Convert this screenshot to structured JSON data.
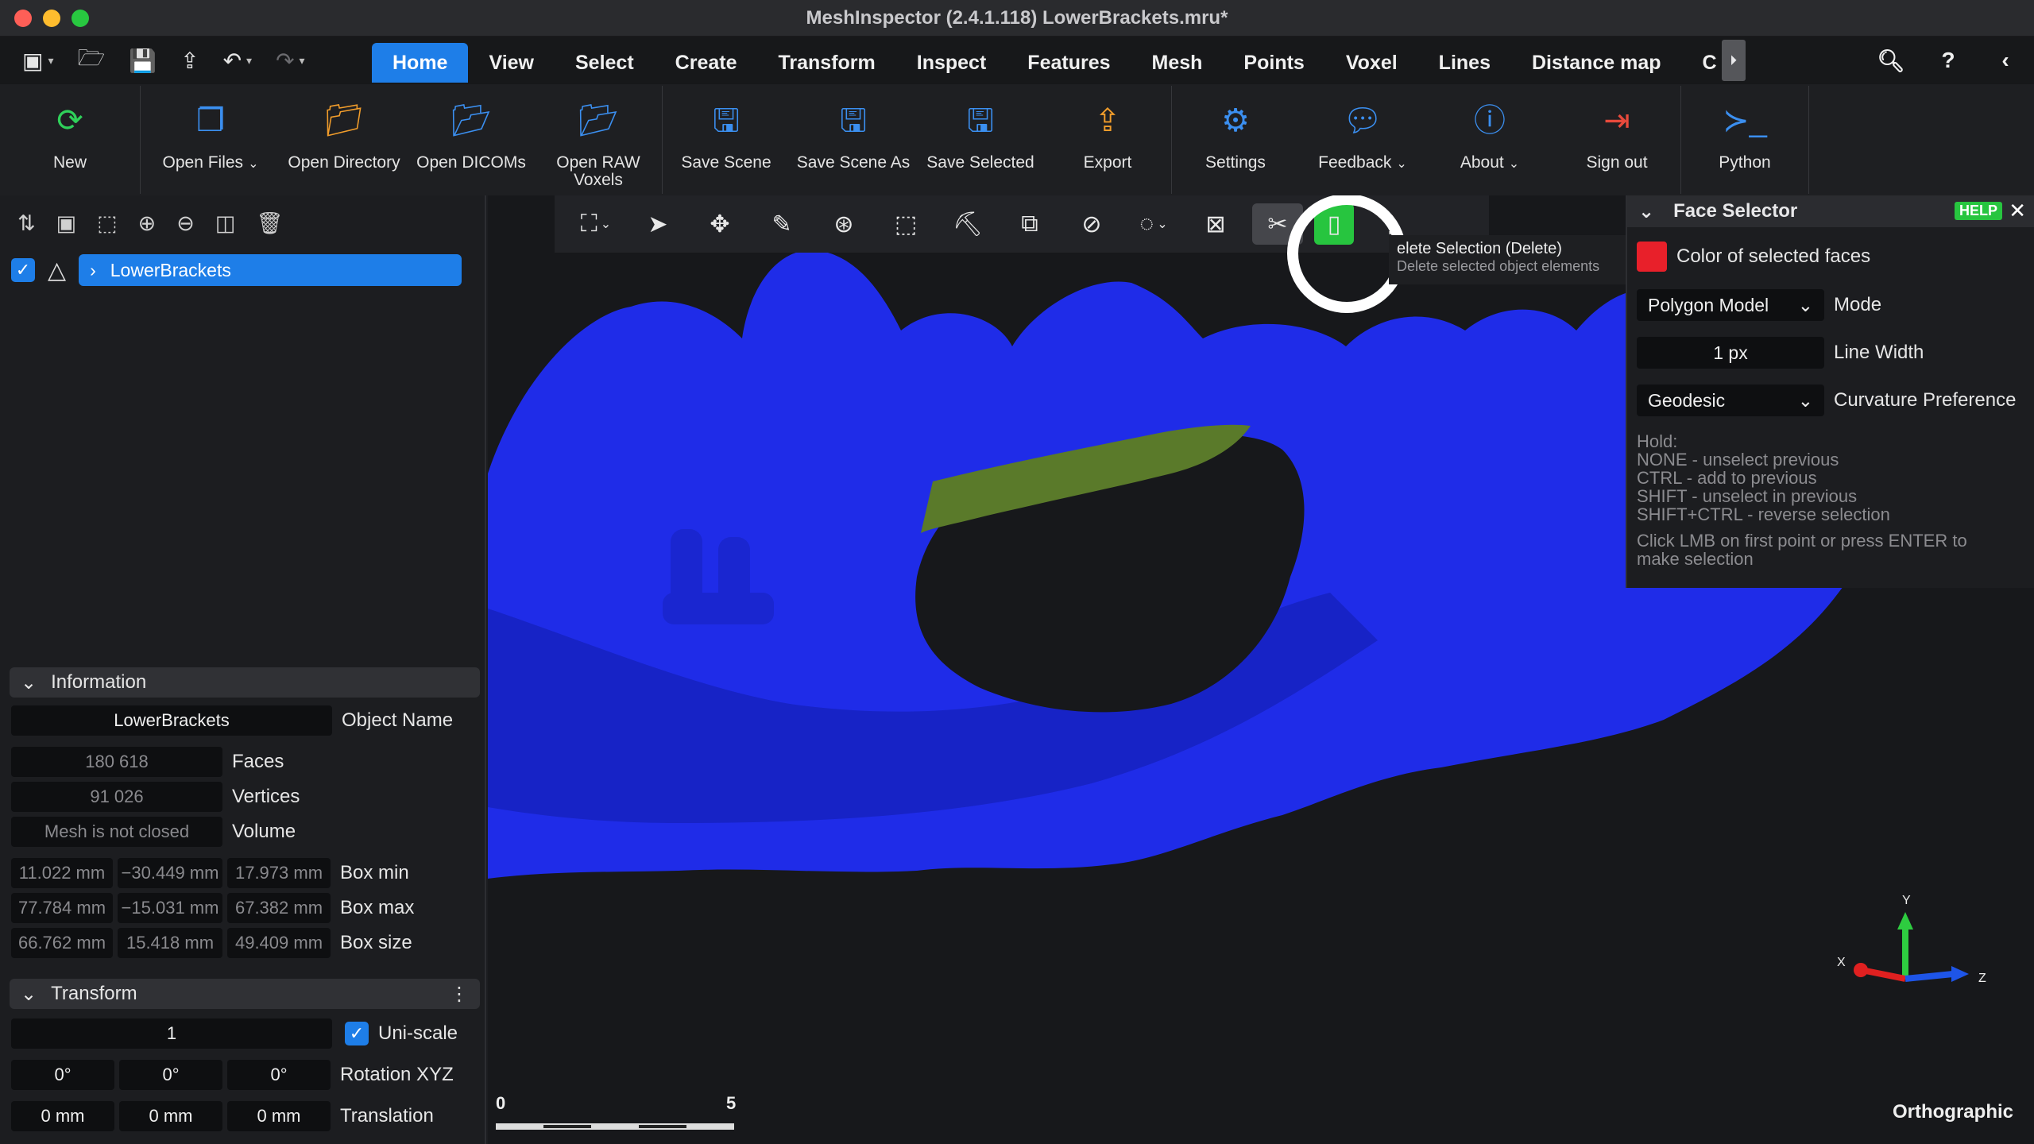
{
  "window": {
    "title": "MeshInspector (2.4.1.118) LowerBrackets.mru*"
  },
  "menubar": {
    "tabs": [
      "Home",
      "View",
      "Select",
      "Create",
      "Transform",
      "Inspect",
      "Features",
      "Mesh",
      "Points",
      "Voxel",
      "Lines",
      "Distance map",
      "C"
    ],
    "active_tab": "Home"
  },
  "ribbon": {
    "new": "New",
    "open_files": "Open Files",
    "open_directory": "Open Directory",
    "open_dicoms": "Open DICOMs",
    "open_raw_voxels_1": "Open RAW",
    "open_raw_voxels_2": "Voxels",
    "save_scene": "Save Scene",
    "save_scene_as": "Save Scene As",
    "save_selected": "Save Selected",
    "export": "Export",
    "settings": "Settings",
    "feedback": "Feedback",
    "about": "About",
    "sign_out": "Sign out",
    "python": "Python"
  },
  "scene_tree": {
    "object_name": "LowerBrackets",
    "checked": true
  },
  "information": {
    "header": "Information",
    "object_name_value": "LowerBrackets",
    "object_name_label": "Object Name",
    "faces_value": "180 618",
    "faces_label": "Faces",
    "vertices_value": "91 026",
    "vertices_label": "Vertices",
    "volume_value": "Mesh is not closed",
    "volume_label": "Volume",
    "box_min": [
      "11.022 mm",
      "−30.449 mm",
      "17.973 mm"
    ],
    "box_min_label": "Box min",
    "box_max": [
      "77.784 mm",
      "−15.031 mm",
      "67.382 mm"
    ],
    "box_max_label": "Box max",
    "box_size": [
      "66.762 mm",
      "15.418 mm",
      "49.409 mm"
    ],
    "box_size_label": "Box size"
  },
  "transform": {
    "header": "Transform",
    "scale_value": "1",
    "uniscale_label": "Uni-scale",
    "rotation": [
      "0°",
      "0°",
      "0°"
    ],
    "rotation_label": "Rotation XYZ",
    "translation": [
      "0 mm",
      "0 mm",
      "0 mm"
    ],
    "translation_label": "Translation"
  },
  "tooltip": {
    "title": "elete Selection (Delete)",
    "description": "Delete selected object elements"
  },
  "face_selector": {
    "title": "Face Selector",
    "help": "HELP",
    "color_label": "Color of selected faces",
    "color": "#e8202a",
    "mode_value": "Polygon Model",
    "mode_label": "Mode",
    "line_width_value": "1 px",
    "line_width_label": "Line Width",
    "curvature_value": "Geodesic",
    "curvature_label": "Curvature Preference",
    "hint_lines": [
      "Hold:",
      "NONE - unselect previous",
      "CTRL - add to previous",
      "SHIFT - unselect in previous",
      "SHIFT+CTRL - reverse selection",
      "",
      "Click LMB on first point or press ENTER to",
      "make selection"
    ]
  },
  "viewport": {
    "projection": "Orthographic",
    "scale_min": "0",
    "scale_max": "5",
    "axis_x": "X",
    "axis_y": "Y",
    "axis_z": "Z",
    "mesh_color": "#1f2ce8",
    "selection_color": "#5a7a2a"
  }
}
